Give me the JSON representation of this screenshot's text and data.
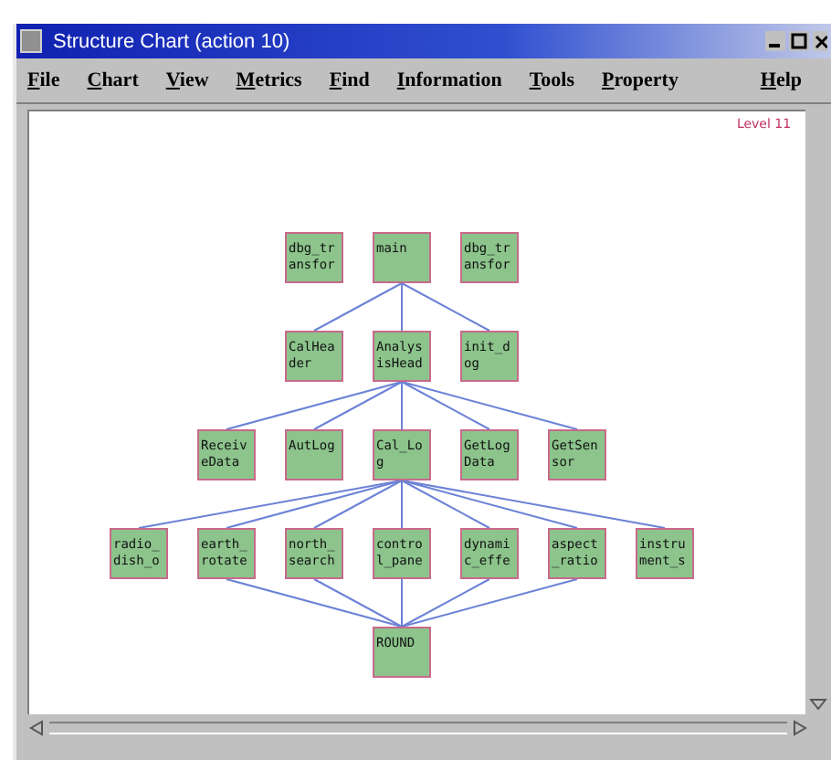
{
  "window": {
    "title": "Structure Chart  (action 10)"
  },
  "menu": [
    "File",
    "Chart",
    "View",
    "Metrics",
    "Find",
    "Information",
    "Tools",
    "Property",
    "Help"
  ],
  "chart": {
    "level_label": "Level 11",
    "levels": [
      [
        {
          "label": "dbg_transfor",
          "hub": false
        },
        {
          "label": "main",
          "hub": true
        },
        {
          "label": "dbg_transfor",
          "hub": false
        }
      ],
      [
        {
          "label": "CalHeader",
          "hub": false,
          "linked_up": true
        },
        {
          "label": "AnalysisHead",
          "hub": true,
          "linked_up": true
        },
        {
          "label": "init_dog",
          "hub": false,
          "linked_up": true
        }
      ],
      [
        {
          "label": "ReceiveData",
          "hub": false,
          "linked_up": true
        },
        {
          "label": "AutLog",
          "hub": false,
          "linked_up": true
        },
        {
          "label": "Cal_Log",
          "hub": true,
          "linked_up": true
        },
        {
          "label": "GetLogData",
          "hub": false,
          "linked_up": true
        },
        {
          "label": "GetSensor",
          "hub": false,
          "linked_up": true
        }
      ],
      [
        {
          "label": "radio_dish_o",
          "linked_up": true,
          "linked_down": false
        },
        {
          "label": "earth_rotate",
          "linked_up": true,
          "linked_down": true
        },
        {
          "label": "north_search",
          "linked_up": true,
          "linked_down": true
        },
        {
          "label": "control_pane",
          "linked_up": true,
          "linked_down": true
        },
        {
          "label": "dynamic_effe",
          "linked_up": true,
          "linked_down": true
        },
        {
          "label": "aspect_ratio",
          "linked_up": true,
          "linked_down": true
        },
        {
          "label": "instrument_s",
          "linked_up": true,
          "linked_down": false
        }
      ],
      [
        {
          "label": "ROUND",
          "hub": true
        }
      ]
    ]
  }
}
